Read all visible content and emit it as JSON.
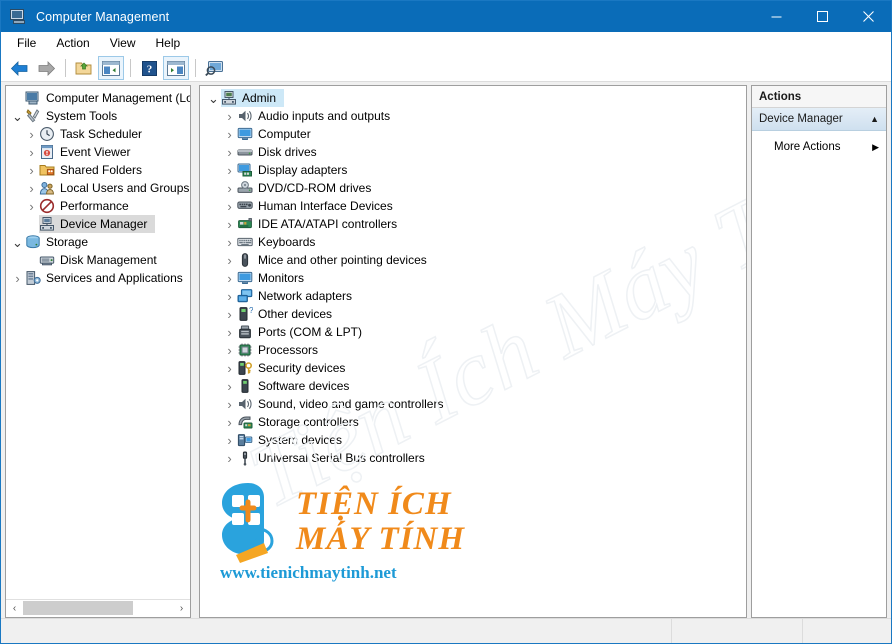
{
  "window": {
    "title": "Computer Management",
    "icon": "computer-management-icon",
    "controls": {
      "minimize": "minimize-icon",
      "maximize": "maximize-icon",
      "close": "close-icon"
    },
    "accent_color": "#0a6cb8"
  },
  "menubar": {
    "items": [
      "File",
      "Action",
      "View",
      "Help"
    ]
  },
  "toolbar": {
    "buttons": [
      {
        "name": "back-button",
        "icon": "back-arrow-icon",
        "framed": false
      },
      {
        "name": "forward-button",
        "icon": "forward-arrow-icon",
        "framed": false
      },
      {
        "name": "up-one-level-button",
        "icon": "folder-up-icon",
        "framed": false
      },
      {
        "name": "show-hide-console-tree-button",
        "icon": "console-tree-icon",
        "framed": true
      },
      {
        "name": "help-button",
        "icon": "help-question-icon",
        "framed": false
      },
      {
        "name": "show-hide-action-pane-button",
        "icon": "action-pane-icon",
        "framed": true
      },
      {
        "name": "properties-button",
        "icon": "monitor-search-icon",
        "framed": false
      }
    ]
  },
  "console_tree": {
    "root": {
      "label": "Computer Management (Local",
      "icon": "computer-management-icon",
      "expanded": true,
      "level": 0
    },
    "items": [
      {
        "label": "System Tools",
        "icon": "system-tools-icon",
        "level": 1,
        "twisty": "expanded",
        "selected": false
      },
      {
        "label": "Task Scheduler",
        "icon": "clock-icon",
        "level": 2,
        "twisty": "collapsed",
        "selected": false
      },
      {
        "label": "Event Viewer",
        "icon": "event-viewer-icon",
        "level": 2,
        "twisty": "collapsed",
        "selected": false
      },
      {
        "label": "Shared Folders",
        "icon": "shared-folders-icon",
        "level": 2,
        "twisty": "collapsed",
        "selected": false
      },
      {
        "label": "Local Users and Groups",
        "icon": "users-groups-icon",
        "level": 2,
        "twisty": "collapsed",
        "selected": false
      },
      {
        "label": "Performance",
        "icon": "performance-icon",
        "level": 2,
        "twisty": "collapsed",
        "selected": false
      },
      {
        "label": "Device Manager",
        "icon": "device-manager-icon",
        "level": 2,
        "twisty": "none",
        "selected": true
      },
      {
        "label": "Storage",
        "icon": "storage-icon",
        "level": 1,
        "twisty": "expanded",
        "selected": false
      },
      {
        "label": "Disk Management",
        "icon": "disk-management-icon",
        "level": 2,
        "twisty": "none",
        "selected": false
      },
      {
        "label": "Services and Applications",
        "icon": "services-apps-icon",
        "level": 1,
        "twisty": "collapsed",
        "selected": false
      }
    ],
    "hscrollbar": {
      "left_arrow": "chevron-left-icon",
      "right_arrow": "chevron-right-icon"
    }
  },
  "device_tree": {
    "root": {
      "label": "Admin",
      "icon": "computer-node-icon",
      "twisty": "expanded",
      "selected": true
    },
    "items": [
      {
        "label": "Audio inputs and outputs",
        "icon": "speaker-icon"
      },
      {
        "label": "Computer",
        "icon": "monitor-icon"
      },
      {
        "label": "Disk drives",
        "icon": "disk-drive-icon"
      },
      {
        "label": "Display adapters",
        "icon": "display-adapter-icon"
      },
      {
        "label": "DVD/CD-ROM drives",
        "icon": "optical-drive-icon"
      },
      {
        "label": "Human Interface Devices",
        "icon": "hid-icon"
      },
      {
        "label": "IDE ATA/ATAPI controllers",
        "icon": "ide-controller-icon"
      },
      {
        "label": "Keyboards",
        "icon": "keyboard-icon"
      },
      {
        "label": "Mice and other pointing devices",
        "icon": "mouse-icon"
      },
      {
        "label": "Monitors",
        "icon": "monitor-icon"
      },
      {
        "label": "Network adapters",
        "icon": "network-adapter-icon"
      },
      {
        "label": "Other devices",
        "icon": "unknown-device-icon"
      },
      {
        "label": "Ports (COM & LPT)",
        "icon": "port-icon"
      },
      {
        "label": "Processors",
        "icon": "processor-icon"
      },
      {
        "label": "Security devices",
        "icon": "security-device-icon"
      },
      {
        "label": "Software devices",
        "icon": "software-device-icon"
      },
      {
        "label": "Sound, video and game controllers",
        "icon": "speaker-icon"
      },
      {
        "label": "Storage controllers",
        "icon": "storage-controller-icon"
      },
      {
        "label": "System devices",
        "icon": "system-device-icon"
      },
      {
        "label": "Universal Serial Bus controllers",
        "icon": "usb-icon"
      }
    ]
  },
  "actions_pane": {
    "title": "Actions",
    "section_label": "Device Manager",
    "section_chevron": "chevron-up-icon",
    "items": [
      {
        "label": "More Actions",
        "chevron": "chevron-right-icon"
      }
    ]
  },
  "watermark": {
    "diagonal_text": "Tiện Ích Máy Tính.Net",
    "logo_line1": "TIỆN ÍCH",
    "logo_line2": "MÁY TÍNH",
    "logo_url": "www.tienichmaytinh.net",
    "logo_color_orange": "#f08a1b",
    "logo_color_blue": "#1d9ad6"
  },
  "statusbar": {
    "text": ""
  }
}
